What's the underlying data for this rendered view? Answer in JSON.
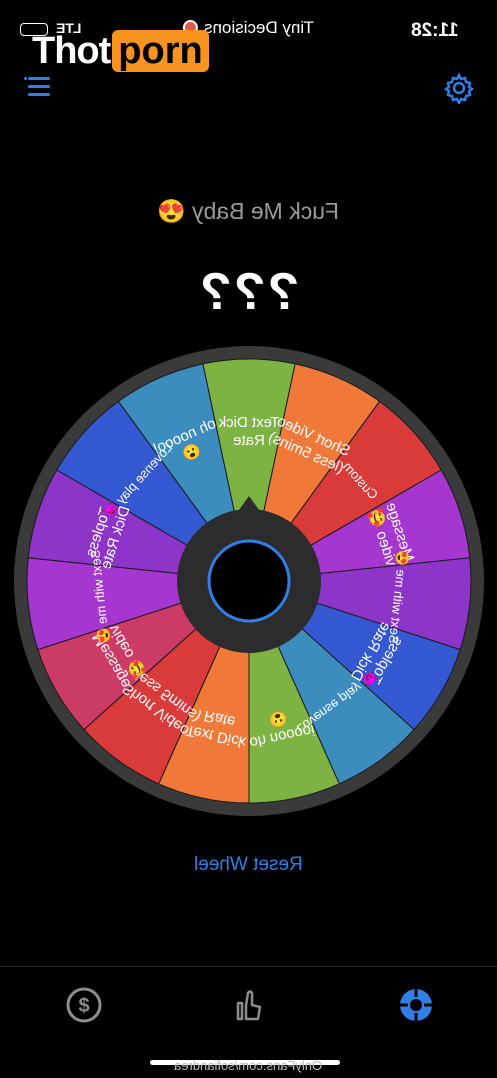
{
  "status_bar": {
    "time": "11:28",
    "app_label": "Tiny Decisions",
    "network": "LTE"
  },
  "watermark": {
    "part1": "Thot",
    "part2": "porn"
  },
  "header": {
    "menu_icon": "list-icon",
    "settings_icon": "gear-icon"
  },
  "wheel": {
    "title": "Fuck Me Baby 😍",
    "result": "???",
    "segments": [
      {
        "label": "Text Dick\nRate",
        "color": "#7cb342"
      },
      {
        "label": "Short Video\n(less 5mins)",
        "color": "#f0793a"
      },
      {
        "label": "Custom",
        "color": "#d93a3a"
      },
      {
        "label": "Message\nvideo 🥰",
        "color": "#a536d0"
      },
      {
        "label": "Sext with me 😍",
        "color": "#8d34c9"
      },
      {
        "label": "Topless\nDick Rate",
        "color": "#3458d1"
      },
      {
        "label": "Lovense play 😈",
        "color": "#3c8dbd"
      },
      {
        "label": "oh nooooi\n😮",
        "color": "#7cb342"
      },
      {
        "label": "Text Dick\nRate",
        "color": "#f0793a"
      },
      {
        "label": "Short Video\n(less 5mins)",
        "color": "#d93a3a"
      },
      {
        "label": "Message\nvideo 🥰",
        "color": "#cc3a66"
      },
      {
        "label": "Sext with me 😍",
        "color": "#a536d0"
      },
      {
        "label": "Topless\nDick Rate",
        "color": "#8d34c9"
      },
      {
        "label": "Lovense play 😈",
        "color": "#3458d1"
      },
      {
        "label": "oh noooo!\n😮",
        "color": "#3c8dbd"
      }
    ]
  },
  "reset_label": "Reset Wheel",
  "tabs": [
    {
      "icon": "dollar-icon"
    },
    {
      "icon": "hand-icon"
    },
    {
      "icon": "wheel-icon"
    }
  ],
  "footer_text": "OnlyFans.com/sofiandrea"
}
